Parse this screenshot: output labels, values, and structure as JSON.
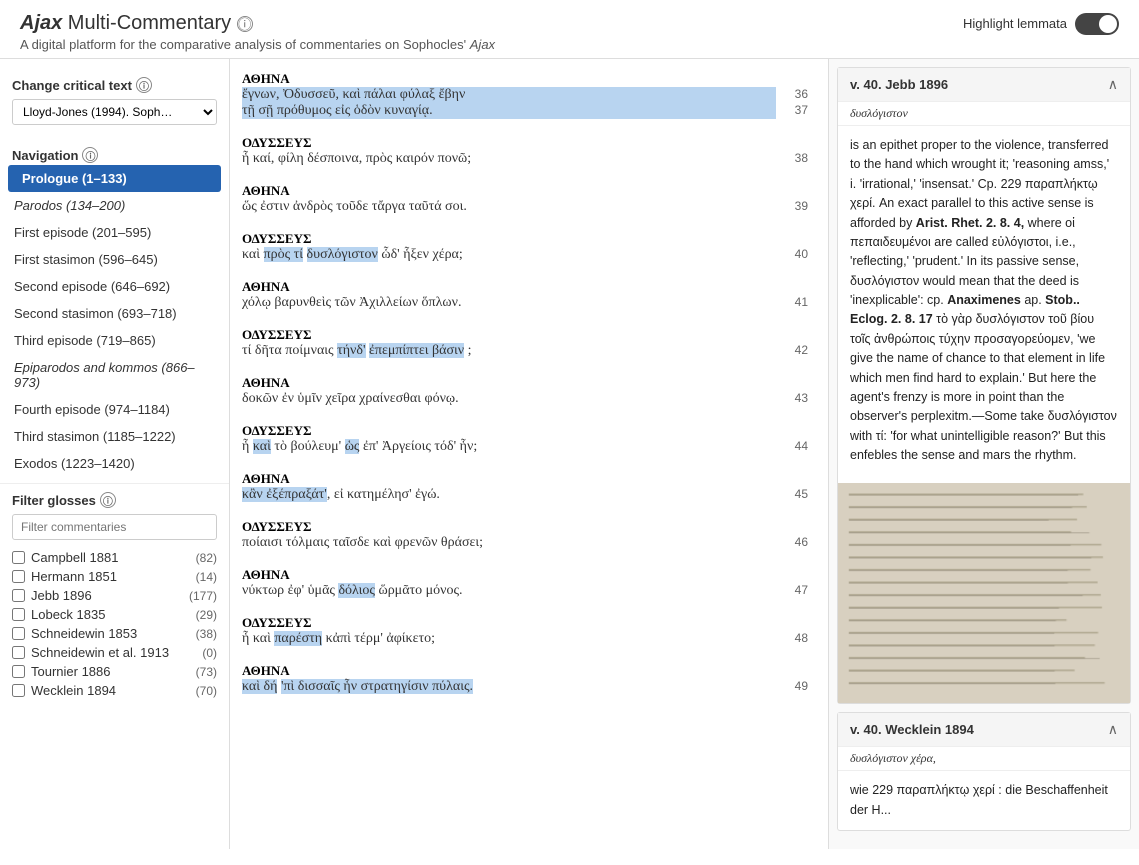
{
  "header": {
    "title_italic": "Ajax",
    "title_rest": " Multi-Commentary",
    "info_icon": "ⓘ",
    "subtitle_prefix": "A digital platform for the comparative analysis of commentaries on Sophocles' ",
    "subtitle_italic": "Ajax",
    "highlight_label": "Highlight lemmata"
  },
  "sidebar": {
    "critical_text_label": "Change critical text",
    "critical_text_value": "Lloyd-Jones (1994). Soph…",
    "navigation_label": "Navigation",
    "nav_items": [
      {
        "label": "Prologue (1–133)",
        "active": true,
        "italic": false
      },
      {
        "label": "Parodos (134–200)",
        "active": false,
        "italic": true
      },
      {
        "label": "First episode (201–595)",
        "active": false,
        "italic": false
      },
      {
        "label": "First stasimon (596–645)",
        "active": false,
        "italic": false
      },
      {
        "label": "Second episode (646–692)",
        "active": false,
        "italic": false
      },
      {
        "label": "Second stasimon (693–718)",
        "active": false,
        "italic": false
      },
      {
        "label": "Third episode (719–865)",
        "active": false,
        "italic": false
      },
      {
        "label": "Epiparodos and kommos (866–973)",
        "active": false,
        "italic": true
      },
      {
        "label": "Fourth episode (974–1184)",
        "active": false,
        "italic": false
      },
      {
        "label": "Third stasimon (1185–1222)",
        "active": false,
        "italic": false
      },
      {
        "label": "Exodos (1223–1420)",
        "active": false,
        "italic": false
      }
    ],
    "filter_label": "Filter glosses",
    "filter_placeholder": "Filter commentaries",
    "commentaries": [
      {
        "name": "Campbell 1881",
        "count": 82,
        "checked": false
      },
      {
        "name": "Hermann 1851",
        "count": 14,
        "checked": false
      },
      {
        "name": "Jebb 1896",
        "count": 177,
        "checked": false
      },
      {
        "name": "Lobeck 1835",
        "count": 29,
        "checked": false
      },
      {
        "name": "Schneidewin 1853",
        "count": 38,
        "checked": false
      },
      {
        "name": "Schneidewin et al. 1913",
        "count": 0,
        "checked": false
      },
      {
        "name": "Tournier 1886",
        "count": 73,
        "checked": false
      },
      {
        "name": "Wecklein 1894",
        "count": 70,
        "checked": false
      }
    ]
  },
  "text_lines": [
    {
      "speaker": "ΑΘΗΝΑ",
      "lines": [
        {
          "text": "ἔγνων, Ὀδυσσεῦ, καὶ πάλαι φύλαξ ἔβην",
          "num": 36,
          "highlight": "selected"
        },
        {
          "text": "τῇ σῇ πρόθυμος εἰς ὁδὸν κυναγίᾳ.",
          "num": 37,
          "highlight": "blue"
        }
      ]
    },
    {
      "speaker": "ΟΔΥΣΣΕΥΣ",
      "lines": [
        {
          "text": "ἦ καί, φίλη δέσποινα, πρὸς καιρόν πονῶ;",
          "num": 38
        }
      ]
    },
    {
      "speaker": "ΑΘΗΝΑ",
      "lines": [
        {
          "text": "ὥς ἐστιν ἀνδρὸς τοῦδε τἄργα ταῦτά σοι.",
          "num": 39
        }
      ]
    },
    {
      "speaker": "ΟΔΥΣΣΕΥΣ",
      "lines": [
        {
          "text": "καὶ πρὸς τί δυσλόγιστον ὧδ' ἧξεν χέρα;",
          "num": 40,
          "highlight_words": [
            "πρὸς τί",
            "δυσλόγιστον"
          ]
        }
      ]
    },
    {
      "speaker": "ΑΘΗΝΑ",
      "lines": [
        {
          "text": "χόλῳ βαρυνθεὶς τῶν Ἀχιλλείων ὅπλων.",
          "num": 41
        }
      ]
    },
    {
      "speaker": "ΟΔΥΣΣΕΥΣ",
      "lines": [
        {
          "text": "τί δῆτα ποίμναις τήνδ' ἐπεμπίπτει βάσιν ;",
          "num": 42,
          "highlight_words": [
            "τήνδ'",
            "ἐπεμπίπτει βάσιν"
          ]
        }
      ]
    },
    {
      "speaker": "ΑΘΗΝΑ",
      "lines": [
        {
          "text": "δοκῶν ἐν ὑμῖν χεῖρα χραίνεσθαι φόνῳ.",
          "num": 43
        }
      ]
    },
    {
      "speaker": "ΟΔΥΣΣΕΥΣ",
      "lines": [
        {
          "text": "ἦ καὶ τὸ βούλευμ' ὡς ἐπ' Ἀργείοις τόδ' ἦν;",
          "num": 44,
          "highlight_words": [
            "καὶ",
            "ὡς"
          ]
        }
      ]
    },
    {
      "speaker": "ΑΘΗΝΑ",
      "lines": [
        {
          "text": "κἂν ἐξέπραξάτ', εἰ κατημέλησ' ἐγώ.",
          "num": 45,
          "highlight_words": [
            "κἂν ἐξέπραξάτ'"
          ]
        }
      ]
    },
    {
      "speaker": "ΟΔΥΣΣΕΥΣ",
      "lines": [
        {
          "text": "ποίαισι τόλμαις ταῖσδε καὶ φρενῶν θράσει;",
          "num": 46
        }
      ]
    },
    {
      "speaker": "ΑΘΗΝΑ",
      "lines": [
        {
          "text": "νύκτωρ ἐφ' ὑμᾶς δόλιος ὥρμᾶτο μόνος.",
          "num": 47,
          "highlight_words": [
            "δόλιος"
          ]
        }
      ]
    },
    {
      "speaker": "ΟΔΥΣΣΕΥΣ",
      "lines": [
        {
          "text": "ἦ καὶ παρέστη κἀπὶ τέρμ' ἀφίκετο;",
          "num": 48,
          "highlight_words": [
            "παρέστη"
          ]
        }
      ]
    },
    {
      "speaker": "ΑΘΗΝΑ",
      "lines": [
        {
          "text": "καὶ δή 'πὶ δισσαῖς ἦν στρατηγίσιν πύλαις.",
          "num": 49,
          "highlight_words": [
            "καὶ δή",
            "'πὶ δισσαῖς ἦν στρατηγίσιν πύλαις."
          ]
        }
      ]
    }
  ],
  "commentary": [
    {
      "version": "v. 40.",
      "author": "Jebb 1896",
      "subtitle": "δυσλόγιστον",
      "expanded": true,
      "body": "is an epithet proper to the violence, transferred to the hand which wrought it; 'reasoning amss,' i. 'irrational,' 'insensat.' Cp. 229 παραπλήκτῳ χερί. An exact parallel to this active sense is afforded by Arist. Rhet. 2. 8. 4, where οἱ πεπαιδευμένοι are called εὐλόγιστοι, i.e., 'reflecting,' 'prudent.' In its passive sense, δυσλόγιστον would mean that the deed is 'inexplicable': cp. Anaximenes ap. Stob.. Eclog. 2. 8. 17 τὸ γὰρ δυσλόγιστον τοῦ βίου τοῖς ἀνθρώποις τύχην προσαγορεύομεν, 'we give the name of chance to that element in life which men find hard to explain.' But here the agent's frenzy is more in point than the observer's perplexitm.—Some take δυσλόγιστον with τί: 'for what unintelligible reason?' But this enfebles the sense and mars the rhythm.",
      "has_image": true
    },
    {
      "version": "v. 40.",
      "author": "Wecklein 1894",
      "subtitle": "δυσλόγιστον χέρα,",
      "expanded": true,
      "body": "wie 229 παραπλήκτῳ χερί : die Beschaffenheit der H..."
    }
  ],
  "icons": {
    "info": "ⓘ",
    "chevron_up": "∧",
    "chevron_down": "∨",
    "toggle_on": "on"
  }
}
